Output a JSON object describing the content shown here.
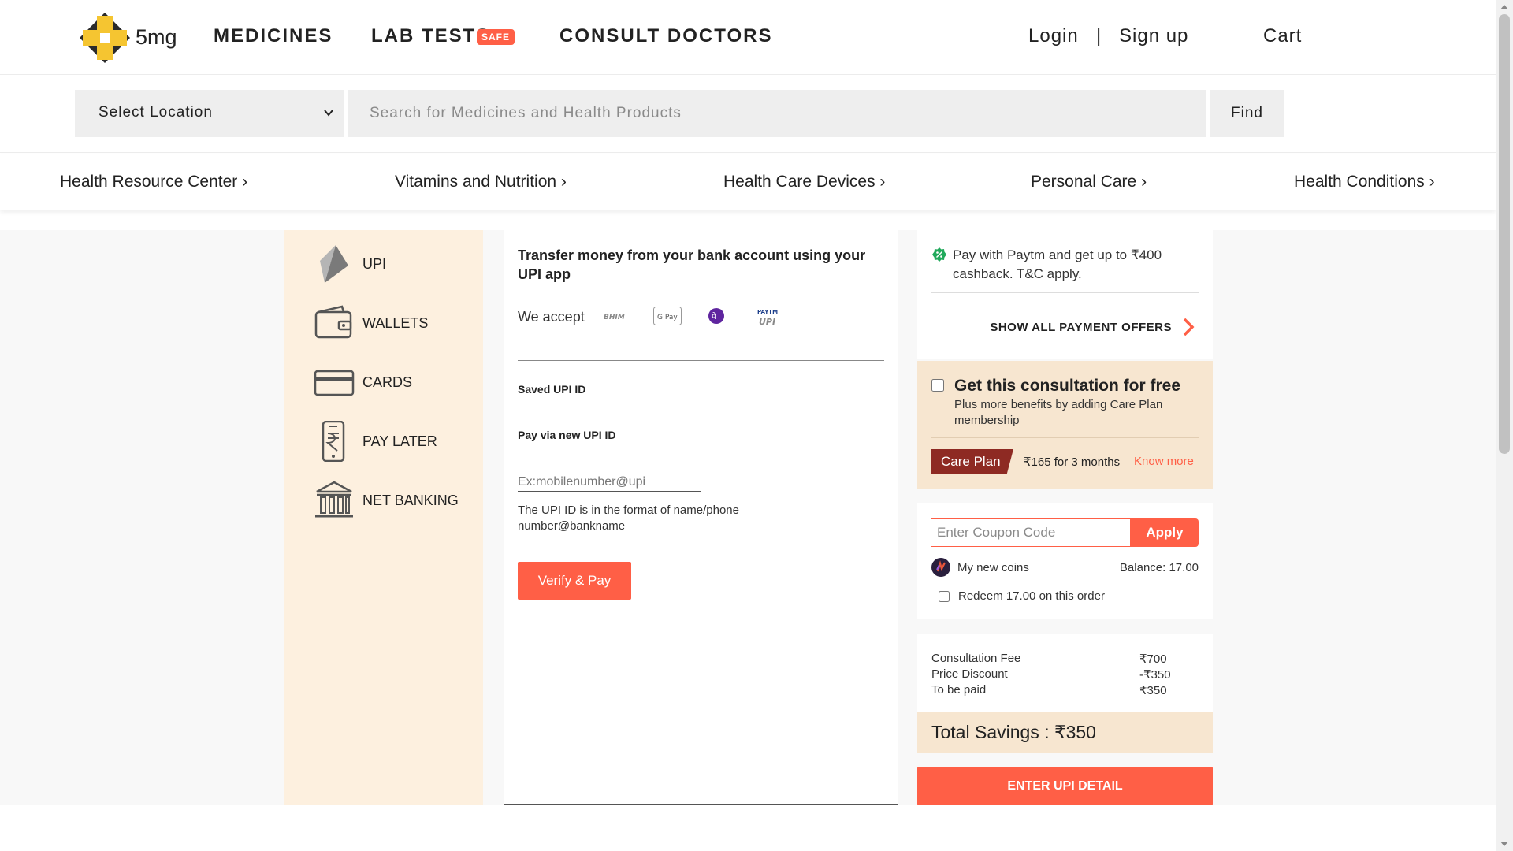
{
  "header": {
    "logo_text": "5mg",
    "nav": {
      "medicines": "MEDICINES",
      "lab_tests": "LAB TESTS",
      "safe_badge": "SAFE",
      "consult_doctors": "CONSULT DOCTORS"
    },
    "login": "Login",
    "separator": "|",
    "signup": "Sign up",
    "cart": "Cart"
  },
  "search": {
    "location_selected": "Select Location",
    "placeholder": "Search for Medicines and Health Products",
    "find_label": "Find"
  },
  "categories": [
    "Health Resource Center ›",
    "Vitamins and Nutrition ›",
    "Health Care Devices ›",
    "Personal Care ›",
    "Health Conditions ›"
  ],
  "payment_methods": [
    {
      "label": "UPI",
      "icon": "upi-icon"
    },
    {
      "label": "WALLETS",
      "icon": "wallet-icon"
    },
    {
      "label": "CARDS",
      "icon": "card-icon"
    },
    {
      "label": "PAY LATER",
      "icon": "phone-rupee-icon"
    },
    {
      "label": "NET BANKING",
      "icon": "bank-icon"
    }
  ],
  "upi": {
    "title": "Transfer money from your bank account using your UPI app",
    "we_accept": "We accept",
    "apps": {
      "bhim": "BHIM",
      "gpay": "G Pay",
      "phonepe": "पे",
      "paytm_top": "PAYTM",
      "paytm_bottom": "UPI"
    },
    "saved_upi_label": "Saved UPI ID",
    "pay_new_label": "Pay via new UPI ID",
    "upi_placeholder": "Ex:mobilenumber@upi",
    "hint": "The UPI ID is in the format of name/phone number@bankname",
    "verify_label": "Verify & Pay"
  },
  "offers": {
    "text": "Pay with Paytm and get up to ₹400 cashback. T&C apply.",
    "show_all_label": "SHOW ALL PAYMENT OFFERS"
  },
  "care_plan": {
    "title": "Get this consultation for free",
    "subtitle": "Plus more benefits by adding Care Plan membership",
    "tag": "Care Plan",
    "price": "₹165 for 3 months",
    "know_more": "Know more"
  },
  "coupon": {
    "placeholder": "Enter Coupon Code",
    "apply_label": "Apply",
    "coins_label": "My new coins",
    "balance": "Balance: 17.00",
    "redeem_label": "Redeem 17.00 on this order"
  },
  "price_summary": {
    "rows": [
      {
        "label": "Consultation Fee",
        "value": "₹700"
      },
      {
        "label": "Price Discount",
        "value": "-₹350"
      },
      {
        "label": "To be paid",
        "value": "₹350"
      }
    ],
    "total_savings": "Total Savings : ₹350"
  },
  "cta_label": "ENTER UPI DETAIL",
  "colors": {
    "accent": "#ff5f46",
    "care_tag": "#8e2a23",
    "method_bg": "#fdf0df",
    "savings_bg": "#f7e6d0",
    "logo_yellow": "#f5c531",
    "offer_green": "#21a95b"
  }
}
